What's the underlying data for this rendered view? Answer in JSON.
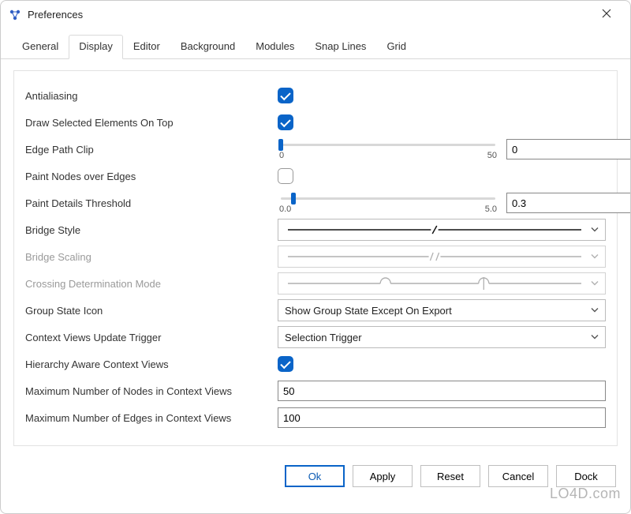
{
  "window": {
    "title": "Preferences"
  },
  "tabs": [
    {
      "label": "General"
    },
    {
      "label": "Display"
    },
    {
      "label": "Editor"
    },
    {
      "label": "Background"
    },
    {
      "label": "Modules"
    },
    {
      "label": "Snap Lines"
    },
    {
      "label": "Grid"
    }
  ],
  "display": {
    "antialiasing": {
      "label": "Antialiasing",
      "checked": true
    },
    "drawSelectedTop": {
      "label": "Draw Selected Elements On Top",
      "checked": true
    },
    "edgePathClip": {
      "label": "Edge Path Clip",
      "min": "0",
      "max": "50",
      "value": "0"
    },
    "paintNodesOverEdges": {
      "label": "Paint Nodes over Edges",
      "checked": false
    },
    "paintDetailsThreshold": {
      "label": "Paint Details Threshold",
      "min": "0.0",
      "max": "5.0",
      "value": "0.3"
    },
    "bridgeStyle": {
      "label": "Bridge Style"
    },
    "bridgeScaling": {
      "label": "Bridge Scaling"
    },
    "crossingMode": {
      "label": "Crossing Determination Mode"
    },
    "groupStateIcon": {
      "label": "Group State Icon",
      "value": "Show Group State Except On Export"
    },
    "contextTrigger": {
      "label": "Context Views Update Trigger",
      "value": "Selection Trigger"
    },
    "hierarchyAware": {
      "label": "Hierarchy Aware Context Views",
      "checked": true
    },
    "maxNodes": {
      "label": "Maximum Number of Nodes in Context Views",
      "value": "50"
    },
    "maxEdges": {
      "label": "Maximum Number of Edges in Context Views",
      "value": "100"
    }
  },
  "footer": {
    "ok": "Ok",
    "apply": "Apply",
    "reset": "Reset",
    "cancel": "Cancel",
    "dock": "Dock"
  },
  "watermark": "LO4D.com"
}
